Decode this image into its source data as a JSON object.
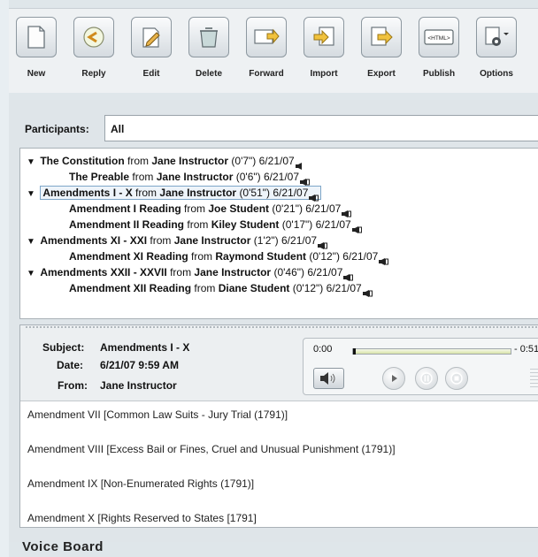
{
  "toolbar": {
    "items": [
      {
        "label": "New",
        "icon": "new-document-icon"
      },
      {
        "label": "Reply",
        "icon": "reply-icon"
      },
      {
        "label": "Edit",
        "icon": "edit-pencil-icon"
      },
      {
        "label": "Delete",
        "icon": "trash-icon"
      },
      {
        "label": "Forward",
        "icon": "forward-icon"
      },
      {
        "label": "Import",
        "icon": "import-icon"
      },
      {
        "label": "Export",
        "icon": "export-icon"
      },
      {
        "label": "Publish",
        "icon": "html-publish-icon"
      },
      {
        "label": "Options",
        "icon": "options-gear-icon"
      }
    ],
    "publish_badge": "<HTML>"
  },
  "participants": {
    "label": "Participants:",
    "value": "All"
  },
  "tree": [
    {
      "title": "The Constitution",
      "from_word": "from",
      "author": "Jane Instructor",
      "meta": "(0'7\") 6/21/07",
      "level": 0,
      "expanded": true
    },
    {
      "title": "The Preable",
      "from_word": "from",
      "author": "Jane Instructor",
      "meta": "(0'6\") 6/21/07",
      "level": 1
    },
    {
      "title": "Amendments I - X",
      "from_word": "from",
      "author": "Jane Instructor",
      "meta": "(0'51\") 6/21/07",
      "level": 0,
      "expanded": true,
      "selected": true
    },
    {
      "title": "Amendment I Reading",
      "from_word": "from",
      "author": "Joe Student",
      "meta": "(0'21\") 6/21/07",
      "level": 1
    },
    {
      "title": "Amendment II Reading",
      "from_word": "from",
      "author": "Kiley Student",
      "meta": "(0'17\") 6/21/07",
      "level": 1
    },
    {
      "title": "Amendments XI - XXI",
      "from_word": "from",
      "author": "Jane Instructor",
      "meta": "(1'2\") 6/21/07",
      "level": 0,
      "expanded": true
    },
    {
      "title": "Amendment XI Reading",
      "from_word": "from",
      "author": "Raymond Student",
      "meta": "(0'12\") 6/21/07",
      "level": 1
    },
    {
      "title": "Amendments XXII - XXVII",
      "from_word": "from",
      "author": "Jane Instructor",
      "meta": "(0'46\") 6/21/07",
      "level": 0,
      "expanded": true
    },
    {
      "title": "Amendment XII Reading",
      "from_word": "from",
      "author": "Diane Student",
      "meta": "(0'12\") 6/21/07",
      "level": 1
    }
  ],
  "message": {
    "subject_label": "Subject:",
    "subject": "Amendments I - X",
    "date_label": "Date:",
    "date": "6/21/07 9:59 AM",
    "from_label": "From:",
    "from": "Jane Instructor",
    "body": [
      "Amendment VII [Common Law Suits - Jury Trial (1791)]",
      "Amendment VIII [Excess Bail or Fines, Cruel and Unusual Punishment (1791)]",
      "Amendment IX [Non-Enumerated Rights (1791)]",
      "Amendment X [Rights Reserved to States [1791]"
    ]
  },
  "player": {
    "current_time": "0:00",
    "remaining_time": "- 0:51",
    "progress": 0.0
  },
  "footer": {
    "title": "Voice Board"
  }
}
